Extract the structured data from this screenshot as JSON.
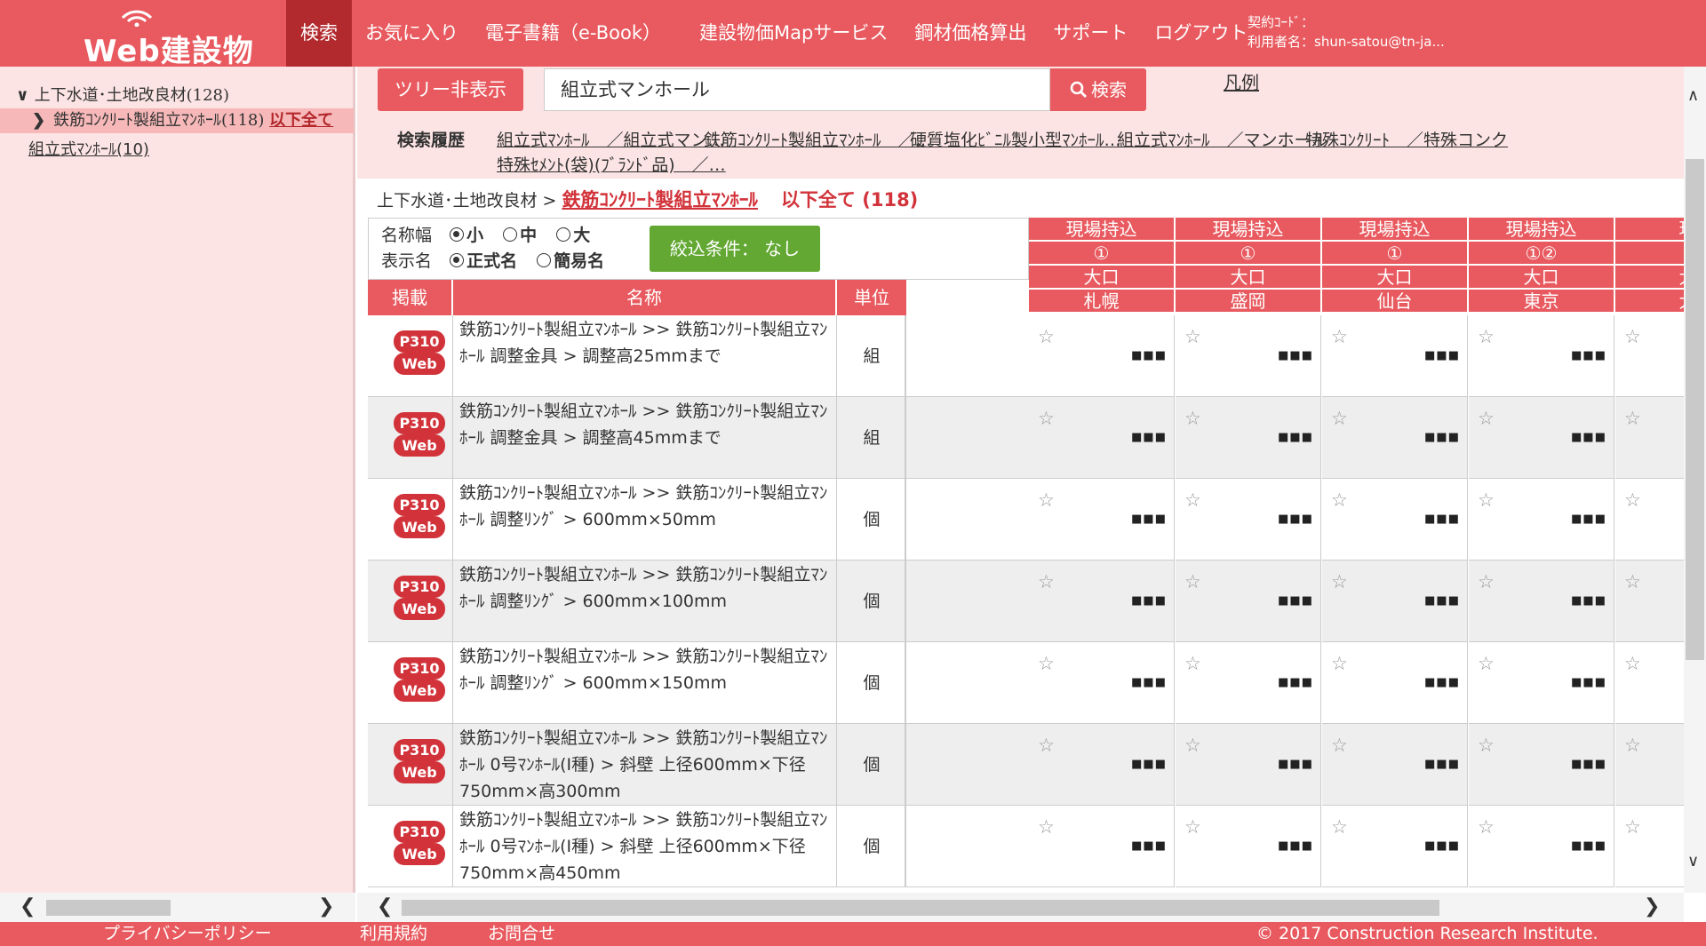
{
  "header": {
    "logo": "Web建設物価",
    "nav": [
      "検索",
      "お気に入り",
      "電子書籍（e-Book）",
      "建設物価Mapサービス",
      "鋼材価格算出",
      "サポート",
      "ログアウト"
    ],
    "contract_label": "契約ｺｰﾄﾞ：",
    "user_label": "利用者名：shun-satou@tn-ja..."
  },
  "tree": {
    "root": "上下水道･土地改良材(128)",
    "selected": "鉄筋ｺﾝｸﾘｰﾄ製組立ﾏﾝﾎｰﾙ(118)",
    "selected_link": "以下全て",
    "child": "組立式ﾏﾝﾎｰﾙ(10)"
  },
  "search": {
    "toggle_label": "ツリー非表示",
    "query": "組立式マンホール",
    "button_label": "検索",
    "legend_link": "凡例",
    "history_label": "検索履歴",
    "history": [
      "組立式ﾏﾝﾎｰﾙ　／組立式マン…",
      "鉄筋ｺﾝｸﾘｰﾄ製組立ﾏﾝﾎｰﾙ　／…",
      "硬質塩化ﾋﾞﾆﾙ製小型ﾏﾝﾎｰﾙ…",
      "組立式ﾏﾝﾎｰﾙ　／マンホール",
      "特殊ｺﾝｸﾘｰﾄ　／特殊コンク",
      "特殊ｾﾒﾝﾄ(袋)(ﾌﾞﾗﾝﾄﾞ品)　／…"
    ]
  },
  "breadcrumb": {
    "parent": "上下水道･土地改良材",
    "sep": ">",
    "current": "鉄筋ｺﾝｸﾘｰﾄ製組立ﾏﾝﾎｰﾙ",
    "all": "以下全て (118)"
  },
  "options": {
    "width_label": "名称幅",
    "width_options": [
      "小",
      "中",
      "大"
    ],
    "display_label": "表示名",
    "display_options": [
      "正式名",
      "簡易名"
    ],
    "filter_label": "絞込条件： なし"
  },
  "table": {
    "headers": [
      "掲載",
      "名称",
      "単位"
    ],
    "regions": [
      {
        "l1": "現場持込",
        "l2": "①",
        "l3": "大口",
        "l4": "札幌"
      },
      {
        "l1": "現場持込",
        "l2": "①",
        "l3": "大口",
        "l4": "盛岡"
      },
      {
        "l1": "現場持込",
        "l2": "①",
        "l3": "大口",
        "l4": "仙台"
      },
      {
        "l1": "現場持込",
        "l2": "①②",
        "l3": "大口",
        "l4": "東京"
      },
      {
        "l1": "現",
        "l2": "",
        "l3": "大",
        "l4": "大"
      }
    ],
    "rows": [
      {
        "page": "P310",
        "web": "Web",
        "name": "鉄筋ｺﾝｸﾘｰﾄ製組立ﾏﾝﾎｰﾙ >> 鉄筋ｺﾝｸﾘｰﾄ製組立ﾏﾝﾎｰﾙ 調整金具 > 調整高25mmまで",
        "unit": "組"
      },
      {
        "page": "P310",
        "web": "Web",
        "name": "鉄筋ｺﾝｸﾘｰﾄ製組立ﾏﾝﾎｰﾙ >> 鉄筋ｺﾝｸﾘｰﾄ製組立ﾏﾝﾎｰﾙ 調整金具 > 調整高45mmまで",
        "unit": "組"
      },
      {
        "page": "P310",
        "web": "Web",
        "name": "鉄筋ｺﾝｸﾘｰﾄ製組立ﾏﾝﾎｰﾙ >> 鉄筋ｺﾝｸﾘｰﾄ製組立ﾏﾝﾎｰﾙ 調整ﾘﾝｸﾞ > 600mm×50mm",
        "unit": "個"
      },
      {
        "page": "P310",
        "web": "Web",
        "name": "鉄筋ｺﾝｸﾘｰﾄ製組立ﾏﾝﾎｰﾙ >> 鉄筋ｺﾝｸﾘｰﾄ製組立ﾏﾝﾎｰﾙ 調整ﾘﾝｸﾞ > 600mm×100mm",
        "unit": "個"
      },
      {
        "page": "P310",
        "web": "Web",
        "name": "鉄筋ｺﾝｸﾘｰﾄ製組立ﾏﾝﾎｰﾙ >> 鉄筋ｺﾝｸﾘｰﾄ製組立ﾏﾝﾎｰﾙ 調整ﾘﾝｸﾞ > 600mm×150mm",
        "unit": "個"
      },
      {
        "page": "P310",
        "web": "Web",
        "name": "鉄筋ｺﾝｸﾘｰﾄ製組立ﾏﾝﾎｰﾙ >> 鉄筋ｺﾝｸﾘｰﾄ製組立ﾏﾝﾎｰﾙ 0号ﾏﾝﾎｰﾙ(Ⅰ種) > 斜壁 上径600mm×下径750mm×高300mm",
        "unit": "個"
      },
      {
        "page": "P310",
        "web": "Web",
        "name": "鉄筋ｺﾝｸﾘｰﾄ製組立ﾏﾝﾎｰﾙ >> 鉄筋ｺﾝｸﾘｰﾄ製組立ﾏﾝﾎｰﾙ 0号ﾏﾝﾎｰﾙ(Ⅰ種) > 斜壁 上径600mm×下径750mm×高450mm",
        "unit": "個"
      }
    ],
    "price_mask": "■■■",
    "star": "☆"
  },
  "footer": {
    "privacy": "プライバシーポリシー",
    "terms": "利用規約",
    "contact": "お問合せ",
    "copyright": "© 2017 Construction Research Institute."
  }
}
